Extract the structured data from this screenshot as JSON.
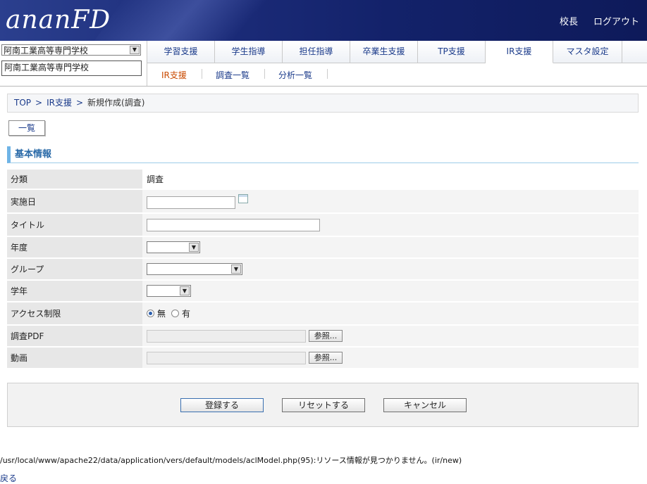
{
  "header": {
    "logo": "ananFD",
    "principal_label": "校長",
    "logout_label": "ログアウト"
  },
  "school": {
    "selected": "阿南工業高等専門学校",
    "name": "阿南工業高等専門学校"
  },
  "tabs": [
    "学習支援",
    "学生指導",
    "担任指導",
    "卒業生支援",
    "TP支援",
    "IR支援",
    "マスタ設定"
  ],
  "subnav": [
    "IR支援",
    "調査一覧",
    "分析一覧"
  ],
  "breadcrumb": [
    "TOP",
    ">",
    "IR支援",
    ">",
    "新規作成(調査)"
  ],
  "list_button": "一覧",
  "section_title": "基本情報",
  "form": {
    "category_label": "分類",
    "category_value": "調査",
    "date_label": "実施日",
    "title_label": "タイトル",
    "year_label": "年度",
    "group_label": "グループ",
    "grade_label": "学年",
    "access_label": "アクセス制限",
    "access_none": "無",
    "access_yes": "有",
    "pdf_label": "調査PDF",
    "video_label": "動画",
    "browse_label": "参照..."
  },
  "actions": {
    "register": "登録する",
    "reset": "リセットする",
    "cancel": "キャンセル"
  },
  "error_message": "/usr/local/www/apache22/data/application/vers/default/models/aclModel.php(95):リソース情報が見つかりません。(ir/new)",
  "back_link": "戻る"
}
